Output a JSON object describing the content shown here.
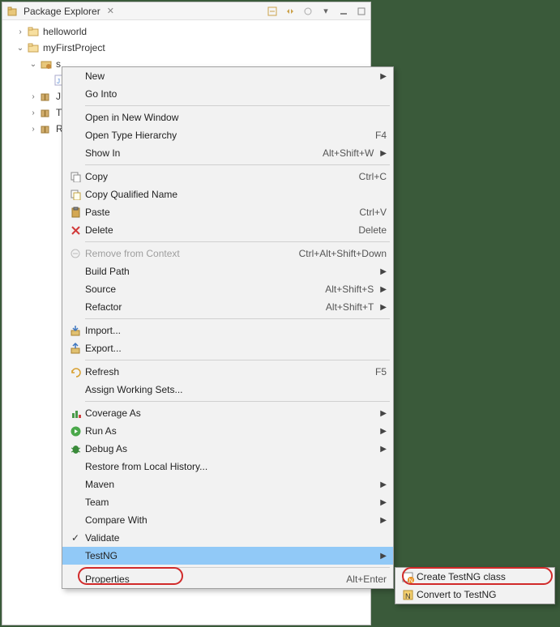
{
  "header": {
    "title": "Package Explorer"
  },
  "tree": {
    "item1": "helloworld",
    "item2": "myFirstProject",
    "item3": "s",
    "item5": "J",
    "item6": "T",
    "item7": "R"
  },
  "menu": {
    "new": "New",
    "goInto": "Go Into",
    "openNewWindow": "Open in New Window",
    "openTypeHierarchy": "Open Type Hierarchy",
    "openTypeHierarchy_sc": "F4",
    "showIn": "Show In",
    "showIn_sc": "Alt+Shift+W",
    "copy": "Copy",
    "copy_sc": "Ctrl+C",
    "copyQualified": "Copy Qualified Name",
    "paste": "Paste",
    "paste_sc": "Ctrl+V",
    "delete": "Delete",
    "delete_sc": "Delete",
    "removeContext": "Remove from Context",
    "removeContext_sc": "Ctrl+Alt+Shift+Down",
    "buildPath": "Build Path",
    "source": "Source",
    "source_sc": "Alt+Shift+S",
    "refactor": "Refactor",
    "refactor_sc": "Alt+Shift+T",
    "import": "Import...",
    "export": "Export...",
    "refresh": "Refresh",
    "refresh_sc": "F5",
    "assignWS": "Assign Working Sets...",
    "coverageAs": "Coverage As",
    "runAs": "Run As",
    "debugAs": "Debug As",
    "restoreLocal": "Restore from Local History...",
    "maven": "Maven",
    "team": "Team",
    "compareWith": "Compare With",
    "validate": "Validate",
    "testng": "TestNG",
    "properties": "Properties",
    "properties_sc": "Alt+Enter"
  },
  "submenu": {
    "createClass": "Create TestNG class",
    "convert": "Convert to TestNG"
  }
}
